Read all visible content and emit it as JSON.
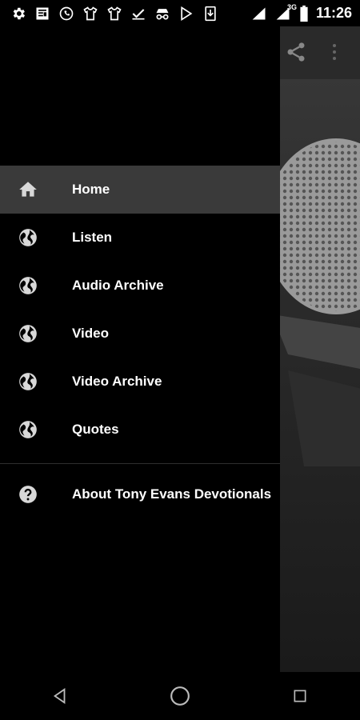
{
  "status_bar": {
    "time": "11:26",
    "network": "3G",
    "left_icons": [
      "gear-icon",
      "news-icon",
      "whatsapp-icon",
      "tshirt-icon",
      "tshirt-icon",
      "checkmark-icon",
      "incognito-icon",
      "play-store-icon",
      "download-icon"
    ]
  },
  "drawer": {
    "items": [
      {
        "label": "Home",
        "icon": "home-icon",
        "active": true
      },
      {
        "label": "Listen",
        "icon": "globe-icon"
      },
      {
        "label": "Audio Archive",
        "icon": "globe-icon"
      },
      {
        "label": "Video",
        "icon": "globe-icon"
      },
      {
        "label": "Video Archive",
        "icon": "globe-icon"
      },
      {
        "label": "Quotes",
        "icon": "globe-icon"
      }
    ],
    "about": {
      "label": "About Tony Evans Devotionals",
      "icon": "help-icon"
    }
  },
  "colors": {
    "drawer_bg": "#000000",
    "active_item_bg": "#3a3a3a",
    "text": "#ffffff",
    "icon": "#d8d8d8"
  }
}
